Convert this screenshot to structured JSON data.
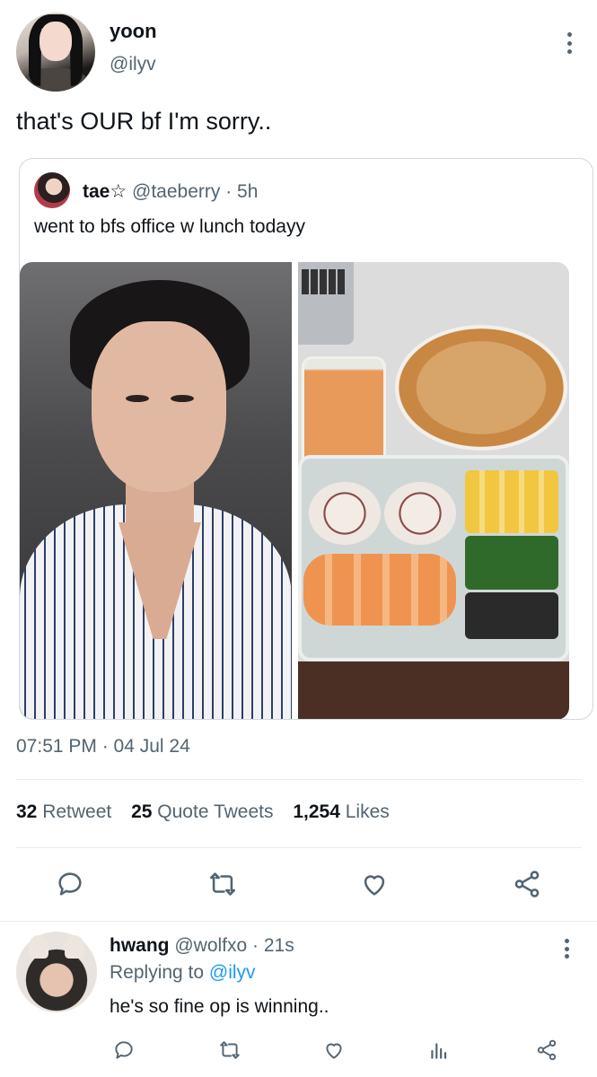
{
  "tweet": {
    "author_name": "yoon",
    "author_handle": "@ilyv",
    "text": "that's OUR bf I'm sorry..",
    "timestamp": "07:51 PM · 04 Jul 24"
  },
  "quoted_tweet": {
    "author_name": "tae☆",
    "author_handle": "@taeberry",
    "time_ago": "· 5h",
    "text": "went to bfs office w lunch todayy"
  },
  "stats": {
    "retweets_count": "32",
    "retweets_label": "Retweet",
    "quotes_count": "25",
    "quotes_label": "Quote Tweets",
    "likes_count": "1,254",
    "likes_label": "Likes"
  },
  "reply": {
    "author_name": "hwang",
    "author_handle": "@wolfxo",
    "time_ago": "· 21s",
    "replying_prefix": "Replying to",
    "replying_handle": "@ilyv",
    "text": "he's so fine op is winning.."
  },
  "icons": {
    "action_color": "#536471",
    "link_color": "#1d9bf0"
  }
}
